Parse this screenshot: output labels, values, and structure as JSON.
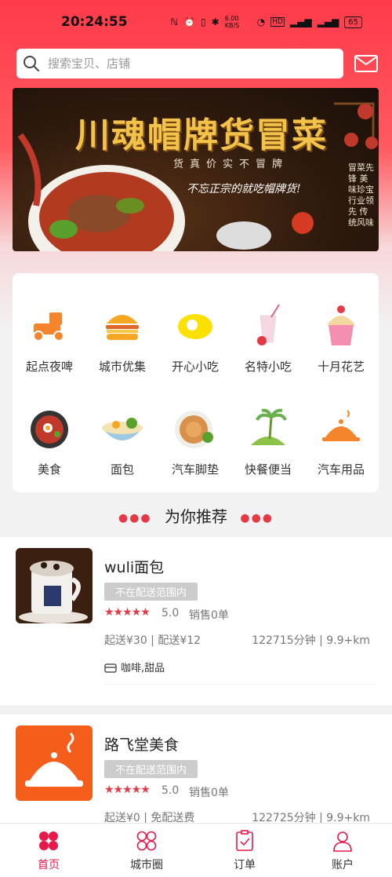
{
  "status_bar": {
    "time": "20:24:55",
    "speed": "6.00 KB/S",
    "battery": "65"
  },
  "search": {
    "placeholder": "搜索宝贝、店铺"
  },
  "banner": {
    "title": "川魂帽牌货冒菜",
    "subtitle": "货真价实不冒牌",
    "slogan": "不忘正宗的就吃帽牌货!",
    "side_text": "冒菜先锋 美味珍宝 行业领先 传统风味"
  },
  "categories": [
    {
      "label": "起点夜啤",
      "icon": "scooter-icon"
    },
    {
      "label": "城市优集",
      "icon": "burger-icon"
    },
    {
      "label": "开心小吃",
      "icon": "egg-icon"
    },
    {
      "label": "名特小吃",
      "icon": "drink-icon"
    },
    {
      "label": "十月花艺",
      "icon": "cupcake-icon"
    },
    {
      "label": "美食",
      "icon": "hotpot-icon"
    },
    {
      "label": "面包",
      "icon": "noodle-bowl-icon"
    },
    {
      "label": "汽车脚垫",
      "icon": "pancake-icon"
    },
    {
      "label": "快餐便当",
      "icon": "island-icon"
    },
    {
      "label": "汽车用品",
      "icon": "cloche-icon"
    }
  ],
  "recommend": {
    "title": "为你推荐"
  },
  "shops": [
    {
      "name": "wuli面包",
      "status_tag": "不在配送范围内",
      "rating": "5.0",
      "sales": "销售0单",
      "fee": "起送¥30 | 配送¥12",
      "distance": "122715分钟 | 9.9+km",
      "tags": "咖啡,甜品"
    },
    {
      "name": "路飞堂美食",
      "status_tag": "不在配送范围内",
      "rating": "5.0",
      "sales": "销售0单",
      "fee": "起送¥0 | 免配送费",
      "distance": "122725分钟 | 9.9+km"
    }
  ],
  "tabbar": {
    "items": [
      {
        "label": "首页",
        "active": true
      },
      {
        "label": "城市圈",
        "active": false
      },
      {
        "label": "订单",
        "active": false
      },
      {
        "label": "账户",
        "active": false
      }
    ]
  },
  "colors": {
    "brand": "#e6194b",
    "header_red": "#ff3a4a",
    "star": "#e63946",
    "icon_orange": "#f5842b",
    "out_of_range_tag": "#cccccc"
  }
}
